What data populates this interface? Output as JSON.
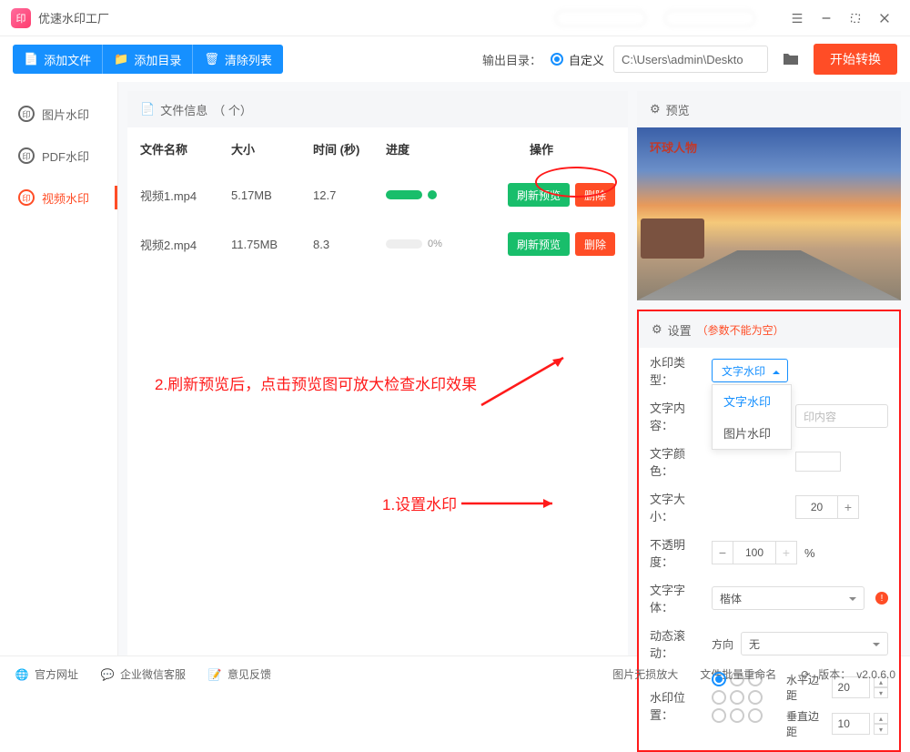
{
  "titlebar": {
    "app_name": "优速水印工厂"
  },
  "toolbar": {
    "add_file": "添加文件",
    "add_dir": "添加目录",
    "clear": "清除列表",
    "output_label": "输出目录：",
    "output_mode": "自定义",
    "output_path": "C:\\Users\\admin\\Deskto",
    "start": "开始转换"
  },
  "sidebar": {
    "items": [
      {
        "label": "图片水印"
      },
      {
        "label": "PDF水印"
      },
      {
        "label": "视频水印"
      }
    ]
  },
  "fileinfo": {
    "title_prefix": "文件信息",
    "title_count": "（ 个）",
    "headers": {
      "name": "文件名称",
      "size": "大小",
      "time": "时间 (秒)",
      "progress": "进度",
      "ops": "操作"
    },
    "rows": [
      {
        "name": "视频1.mp4",
        "size": "5.17MB",
        "time": "12.7",
        "progress_text": "",
        "done": true
      },
      {
        "name": "视频2.mp4",
        "size": "11.75MB",
        "time": "8.3",
        "progress_text": "0%",
        "done": false
      }
    ],
    "refresh": "刷新预览",
    "delete": "删除"
  },
  "preview": {
    "title": "预览",
    "watermark_sample": "环球人物"
  },
  "settings": {
    "title": "设置",
    "warn": "（参数不能为空）",
    "type_label": "水印类型",
    "type_value": "文字水印",
    "type_options": [
      "文字水印",
      "图片水印"
    ],
    "content_label": "文字内容",
    "content_placeholder": "印内容",
    "color_label": "文字颜色",
    "size_label": "文字大小",
    "size_value": "20",
    "opacity_label": "不透明度",
    "opacity_value": "100",
    "opacity_unit": "%",
    "font_label": "文字字体",
    "font_value": "楷体",
    "scroll_label": "动态滚动",
    "scroll_dir_label": "方向",
    "scroll_dir_value": "无",
    "pos_label": "水印位置",
    "margin_h_label": "水平边距",
    "margin_h_value": "20",
    "margin_v_label": "垂直边距",
    "margin_v_value": "10"
  },
  "annotations": {
    "a1": "1.设置水印",
    "a2": "2.刷新预览后，点击预览图可放大检查水印效果"
  },
  "footer": {
    "site": "官方网址",
    "wechat": "企业微信客服",
    "feedback": "意见反馈",
    "zoom": "图片无损放大",
    "rename": "文件批量重命名",
    "version_label": "版本：",
    "version": "v2.0.6.0"
  }
}
